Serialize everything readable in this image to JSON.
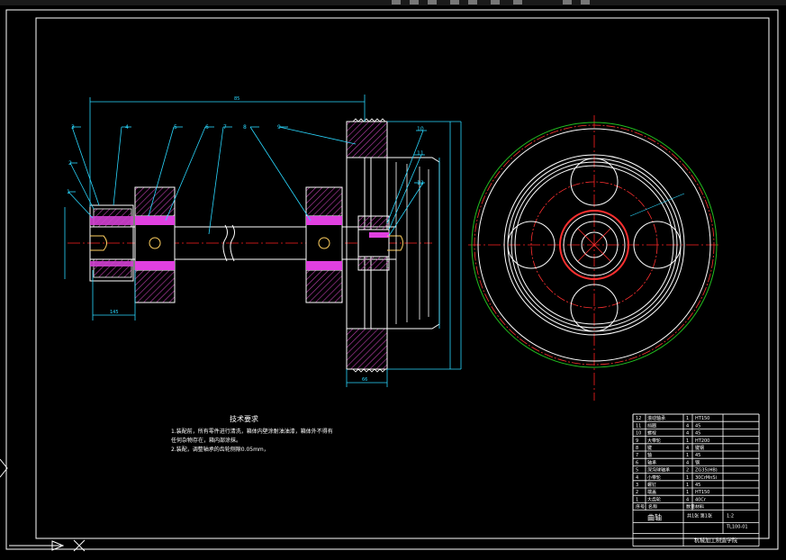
{
  "colors": {
    "background": "#000000",
    "outline": "#ffffff",
    "dimension": "#2ad8ff",
    "hatch": "#b03aa0",
    "center": "#ff2020",
    "keyway": "#ff40ff",
    "bolt": "#ffd060",
    "green": "#20c020"
  },
  "labels": {
    "leaders": [
      "1",
      "2",
      "3",
      "4",
      "5",
      "6",
      "7",
      "8",
      "9",
      "10",
      "11",
      "12"
    ],
    "dims": {
      "overall": "85",
      "left": "145",
      "right": "66"
    }
  },
  "notes": {
    "title": "技术要求",
    "lines": [
      "1.装配前，所有零件进行清洗，箱体内壁涂耐油油漆，箱体外不得有",
      "任何杂物存在，箱内部涂抹。",
      "2.装配，调整轴承的齿轮侧隙0.05mm，"
    ]
  },
  "parts_table": {
    "rows": [
      [
        "12",
        "滚动轴承",
        "1",
        "HT150"
      ],
      [
        "11",
        "挡圈",
        "4",
        "45"
      ],
      [
        "10",
        "螺栓",
        "4",
        "45"
      ],
      [
        "9",
        "大带轮",
        "1",
        "HT200"
      ],
      [
        "8",
        "键",
        "4",
        "键钢"
      ],
      [
        "7",
        "轴",
        "1",
        "45"
      ],
      [
        "6",
        "轴承",
        "4",
        "钢"
      ],
      [
        "5",
        "深沟球轴承",
        "2",
        "ZG35(HB)"
      ],
      [
        "4",
        "小带轮",
        "1",
        "30CrMnSi"
      ],
      [
        "3",
        "螺钉",
        "1",
        "45"
      ],
      [
        "2",
        "端盖",
        "1",
        "HT150"
      ],
      [
        "1",
        "大齿轮",
        "4",
        "40Cr"
      ]
    ],
    "header": [
      "序号",
      "名称",
      "数量",
      "材料"
    ],
    "sheet": "共1张 第1张",
    "scale": "1:2",
    "code": "TL100-01",
    "name": "曲轴",
    "school": "机械加工制造学院"
  }
}
